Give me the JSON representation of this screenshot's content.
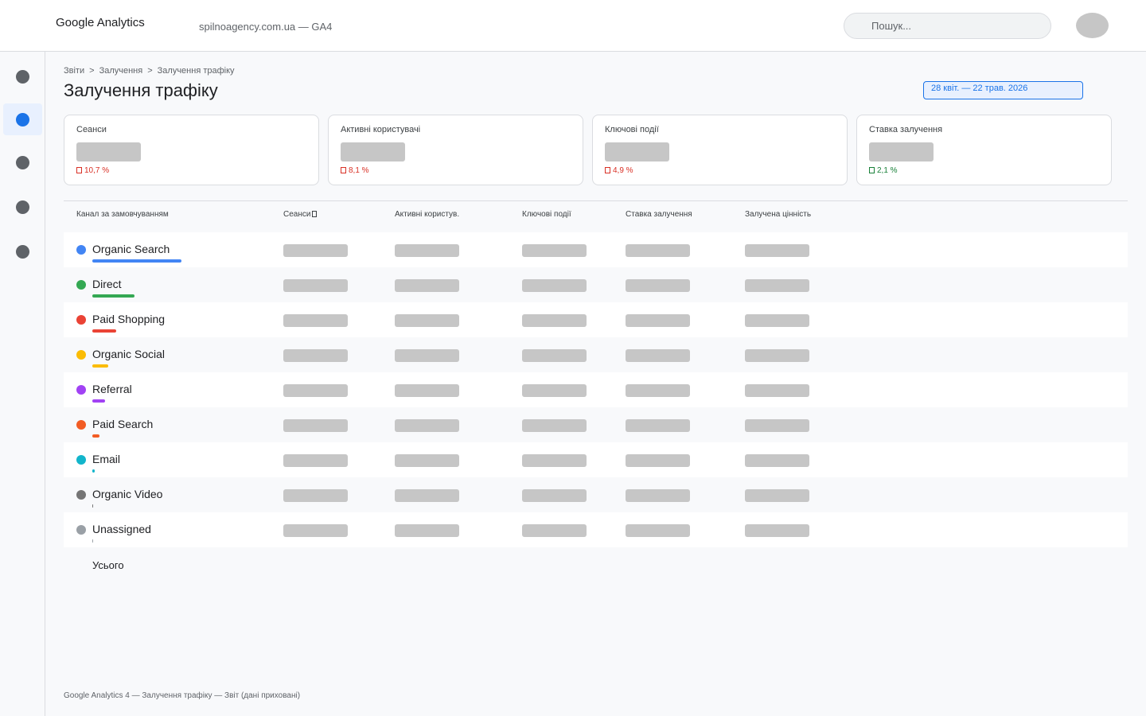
{
  "header": {
    "app_title": "Google Analytics",
    "property": "spilnoagency.com.ua — GA4",
    "search_placeholder": "Пошук..."
  },
  "sidebar": {
    "items": [
      {
        "icon": "nav-icon",
        "active": false
      },
      {
        "icon": "nav-icon",
        "active": true
      },
      {
        "icon": "nav-icon",
        "active": false
      },
      {
        "icon": "nav-icon",
        "active": false
      },
      {
        "icon": "nav-icon",
        "active": false
      }
    ]
  },
  "breadcrumb": [
    "Звіти",
    "Залучення",
    "Залучення трафіку"
  ],
  "page_title": "Залучення трафіку",
  "date_range": "28 квіт. — 22 трав. 2026",
  "kpis": [
    {
      "label": "Сеанси",
      "delta": "10,7 %",
      "trend": "down"
    },
    {
      "label": "Активні користувачі",
      "delta": "8,1 %",
      "trend": "down"
    },
    {
      "label": "Ключові події",
      "delta": "4,9 %",
      "trend": "down"
    },
    {
      "label": "Ставка залучення",
      "delta": "2,1 %",
      "trend": "up"
    }
  ],
  "table": {
    "columns": [
      "Канал за замовчуванням",
      "Сеанси",
      "Активні користув.",
      "Ключові події",
      "Ставка залучення",
      "Залучена цінність"
    ],
    "rows": [
      {
        "channel": "Organic Search",
        "color": "#4285f4",
        "share": 1.0
      },
      {
        "channel": "Direct",
        "color": "#34a853",
        "share": 0.47
      },
      {
        "channel": "Paid Shopping",
        "color": "#ea4335",
        "share": 0.27
      },
      {
        "channel": "Organic Social",
        "color": "#fbbc04",
        "share": 0.18
      },
      {
        "channel": "Referral",
        "color": "#a142f4",
        "share": 0.14
      },
      {
        "channel": "Paid Search",
        "color": "#f25c24",
        "share": 0.08
      },
      {
        "channel": "Email",
        "color": "#12b5cb",
        "share": 0.03
      },
      {
        "channel": "Organic Video",
        "color": "#757575",
        "share": 0.01
      },
      {
        "channel": "Unassigned",
        "color": "#9aa0a6",
        "share": 0.01
      }
    ],
    "total_label": "Усього"
  },
  "footer": "Google Analytics 4 — Залучення трафіку — Звіт (дані приховані)"
}
